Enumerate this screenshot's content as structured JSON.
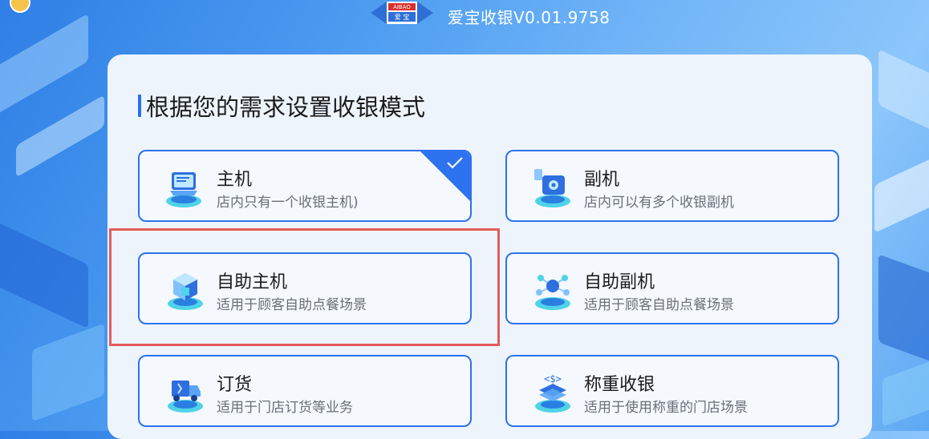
{
  "window": {
    "title": "爱宝收银V0.01.9758",
    "logo_text_top": "AIBAO",
    "logo_text_bottom": "爱 宝"
  },
  "main": {
    "heading": "根据您的需求设置收银模式",
    "accent_color": "#2d72ee",
    "selection_color": "#2d72ee",
    "highlight_color": "#e35b5b",
    "cards": [
      {
        "title": "主机",
        "desc": "店内只有一个收银主机)",
        "icon": "host-computer-icon",
        "selected": true
      },
      {
        "title": "副机",
        "desc": "店内可以有多个收银副机",
        "icon": "secondary-terminal-icon",
        "selected": false
      },
      {
        "title": "自助主机",
        "desc": "适用于顾客自助点餐场景",
        "icon": "self-service-host-icon",
        "selected": false
      },
      {
        "title": "自助副机",
        "desc": "适用于顾客自助点餐场景",
        "icon": "self-service-secondary-icon",
        "selected": false
      },
      {
        "title": "订货",
        "desc": "适用于门店订货等业务",
        "icon": "delivery-truck-icon",
        "selected": false
      },
      {
        "title": "称重收银",
        "desc": "适用于使用称重的门店场景",
        "icon": "weighing-scale-icon",
        "selected": false
      }
    ]
  }
}
